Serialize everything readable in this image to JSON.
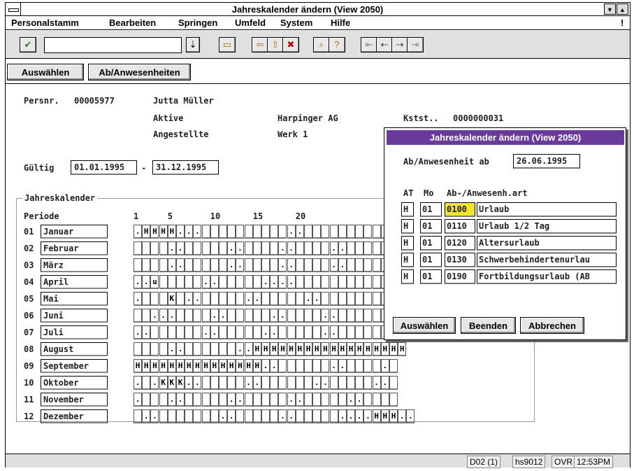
{
  "window": {
    "title": "Jahreskalender ändern (View 2050)"
  },
  "menubar": {
    "items": [
      "Personalstamm",
      "Bearbeiten",
      "Springen",
      "Umfeld",
      "System",
      "Hilfe"
    ],
    "help_glyph": "!"
  },
  "toolbar": {
    "command_value": "",
    "icons": [
      "check-icon",
      "dropdown-icon",
      "folder-icon",
      "back-arrow-icon",
      "up-arrow-icon",
      "cancel-x-icon",
      "find-icon",
      "help-icon",
      "first-page-icon",
      "prev-page-icon",
      "next-page-icon",
      "last-page-icon"
    ]
  },
  "appbar": {
    "buttons": [
      "Auswählen",
      "Ab/Anwesenheiten"
    ]
  },
  "header": {
    "persnr_label": "Persnr.",
    "persnr": "00005977",
    "name": "Jutta Müller",
    "status": "Aktive",
    "company": "Harpinger AG",
    "kstst_label": "Kstst..",
    "kstst": "0000000031",
    "group": "Angestellte",
    "plant": "Werk 1",
    "gueltig_label": "Gültig",
    "gueltig_from": "01.01.1995",
    "gueltig_sep": "-",
    "gueltig_to": "31.12.1995"
  },
  "calendar": {
    "group_title": "Jahreskalender",
    "periode_label": "Periode",
    "day_ticks": [
      {
        "label": "1",
        "day": 1
      },
      {
        "label": "5",
        "day": 5
      },
      {
        "label": "10",
        "day": 10
      },
      {
        "label": "15",
        "day": 15
      },
      {
        "label": "20",
        "day": 20
      }
    ],
    "months": [
      {
        "num": "01",
        "name": "Januar",
        "days": ".HHHH...          ..             "
      },
      {
        "num": "02",
        "name": "Februar",
        "days": "    ..     ..    ..    ..       "
      },
      {
        "num": "03",
        "name": "März",
        "days": "    ..     ..    ..    ..       "
      },
      {
        "num": "04",
        "name": "April",
        "days": "..u     ..     ....              "
      },
      {
        "num": "05",
        "name": "Mai",
        "days": ".   K ..     ..     ..          "
      },
      {
        "num": "06",
        "name": "Juni",
        "days": "  ...    ..     ..    ..       "
      },
      {
        "num": "07",
        "name": "Juli",
        "days": "..      ..     ..     ..       "
      },
      {
        "num": "08",
        "name": "August",
        "days": "    ..      ..HHHHHHHHHHHHHHHHHH"
      },
      {
        "num": "09",
        "name": "September",
        "days": "HHHHHHHHHHHHHHH..      ..    . "
      },
      {
        "num": "10",
        "name": "Oktober",
        "days": ". .KKK..     ..      ..     .. "
      },
      {
        "num": "11",
        "name": "November",
        "days": ".   ..     ..     ..     ..    "
      },
      {
        "num": "12",
        "name": "Dezember",
        "days": " ..       ..     ..     ....HHH.."
      }
    ]
  },
  "popup": {
    "title": "Jahreskalender ändern (View 2050)",
    "ab_label": "Ab/Anwesenheit ab",
    "ab_date": "26.06.1995",
    "col_at": "AT",
    "col_mo": "Mo",
    "col_art": "Ab-/Anwesenh.art",
    "rows": [
      {
        "at": "H",
        "mo": "01",
        "code": "0100",
        "text": "Urlaub",
        "selected": true
      },
      {
        "at": "H",
        "mo": "01",
        "code": "0110",
        "text": "Urlaub 1/2 Tag",
        "selected": false
      },
      {
        "at": "H",
        "mo": "01",
        "code": "0120",
        "text": "Altersurlaub",
        "selected": false
      },
      {
        "at": "H",
        "mo": "01",
        "code": "0130",
        "text": "Schwerbehindertenurlau",
        "selected": false
      },
      {
        "at": "H",
        "mo": "01",
        "code": "0190",
        "text": "Fortbildungsurlaub (AB",
        "selected": false
      }
    ],
    "buttons": [
      "Auswählen",
      "Beenden",
      "Abbrechen"
    ]
  },
  "statusbar": {
    "session": "D02 (1)",
    "server": "hs9012",
    "mode": "OVR",
    "time": "12:53PM"
  },
  "colors": {
    "popup_title_bg": "#6a3a9a",
    "selected_code_bg": "#f2e52a"
  }
}
